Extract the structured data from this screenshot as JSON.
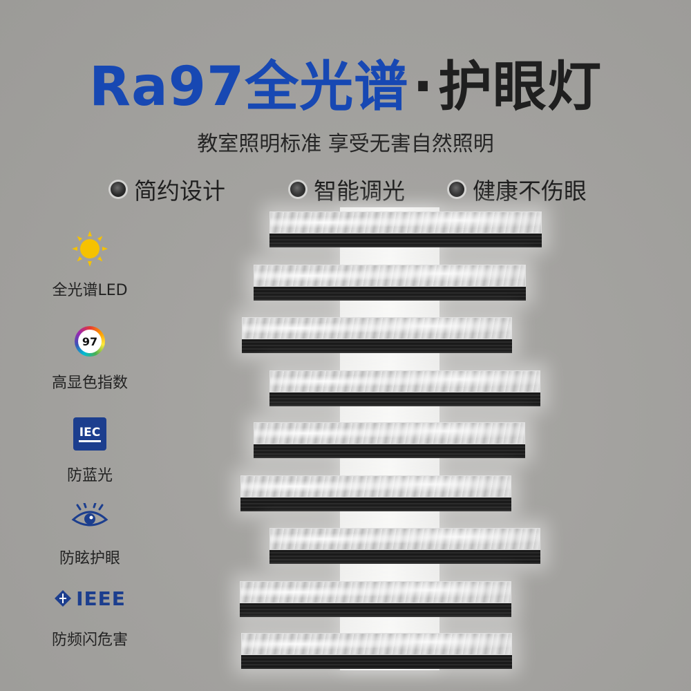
{
  "header": {
    "title_part1": "Ra97全光谱",
    "title_sep": "·",
    "title_part2": "护眼灯",
    "subtitle": "教室照明标准  享受无害自然照明"
  },
  "features": [
    {
      "label": "简约设计"
    },
    {
      "label": "智能调光"
    },
    {
      "label": "健康不伤眼"
    }
  ],
  "badges": [
    {
      "label": "全光谱LED",
      "icon": "sun-icon"
    },
    {
      "label": "高显色指数",
      "icon": "ra-color-icon",
      "icon_text": "97"
    },
    {
      "label": "防蓝光",
      "icon": "iec-logo-icon",
      "icon_text": "IEC"
    },
    {
      "label": "防眩护眼",
      "icon": "eye-icon"
    },
    {
      "label": "防频闪危害",
      "icon": "ieee-logo-icon",
      "icon_text": "IEEE"
    }
  ],
  "colors": {
    "accent_blue": "#1748b3",
    "text_dark": "#1f1f1f",
    "sun_yellow": "#f6c200",
    "logo_blue": "#1c3e8e"
  }
}
